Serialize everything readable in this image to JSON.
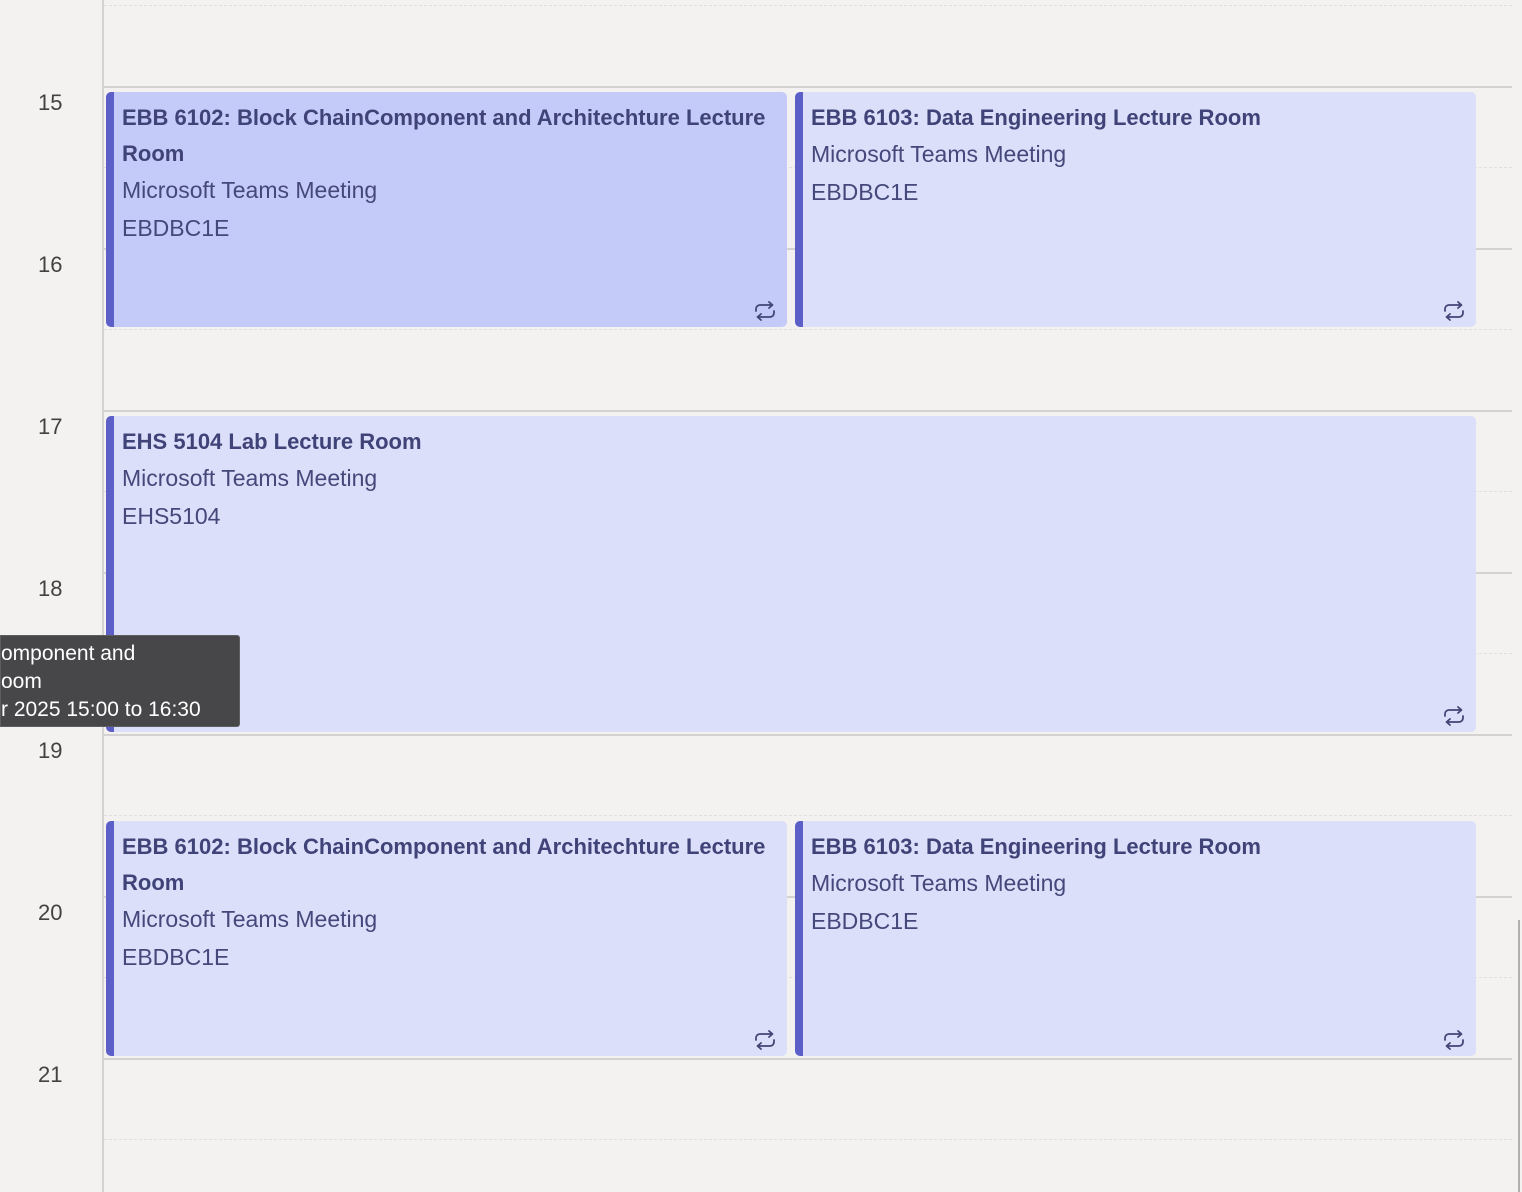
{
  "hours": [
    "15",
    "16",
    "17",
    "18",
    "19",
    "20",
    "21"
  ],
  "events": [
    {
      "title": "EBB 6102: Block ChainComponent and Architechture Lecture Room",
      "location": "Microsoft Teams Meeting",
      "code": "EBDBC1E",
      "recurring": true,
      "selected": true
    },
    {
      "title": "EBB 6103: Data Engineering Lecture Room",
      "location": "Microsoft Teams Meeting",
      "code": "EBDBC1E",
      "recurring": true,
      "selected": false
    },
    {
      "title": "EHS 5104 Lab Lecture Room",
      "location": "Microsoft Teams Meeting",
      "code": "EHS5104",
      "recurring": true,
      "selected": false
    },
    {
      "title": "EBB 6102: Block ChainComponent and Architechture Lecture Room",
      "location": "Microsoft Teams Meeting",
      "code": "EBDBC1E",
      "recurring": true,
      "selected": false
    },
    {
      "title": "EBB 6103: Data Engineering Lecture Room",
      "location": "Microsoft Teams Meeting",
      "code": "EBDBC1E",
      "recurring": true,
      "selected": false
    }
  ],
  "tooltip": {
    "line1": "omponent and",
    "line2": "oom",
    "line3": "r 2025 15:00 to  16:30"
  },
  "colors": {
    "event_bg": "#dcdff9",
    "event_selected_bg": "#c5cbf9",
    "event_accent": "#5b5fc7",
    "background": "#f3f2f1",
    "tooltip_bg": "#474749"
  },
  "icons": {
    "recurrence": "recurring-icon"
  }
}
